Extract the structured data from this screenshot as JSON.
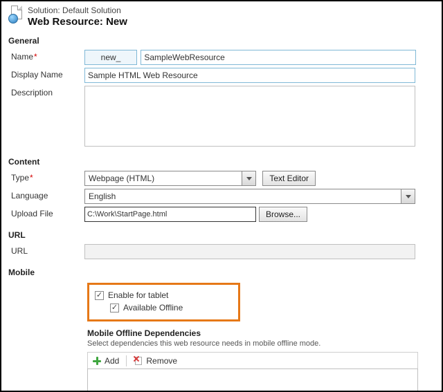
{
  "header": {
    "solution_label": "Solution:",
    "solution_name": "Default Solution",
    "title": "Web Resource: New"
  },
  "sections": {
    "general": "General",
    "content": "Content",
    "url": "URL",
    "mobile": "Mobile"
  },
  "labels": {
    "name": "Name",
    "display_name": "Display Name",
    "description": "Description",
    "type": "Type",
    "language": "Language",
    "upload_file": "Upload File",
    "url": "URL",
    "mobile_deps": "Mobile Offline Dependencies",
    "mobile_deps_desc": "Select dependencies this web resource needs in mobile offline mode."
  },
  "fields": {
    "name_prefix": "new_",
    "name_value": "SampleWebResource",
    "display_name_value": "Sample HTML Web Resource",
    "description_value": "",
    "type_selected": "Webpage (HTML)",
    "language_selected": "English",
    "upload_path": "C:\\Work\\StartPage.html",
    "url_value": ""
  },
  "buttons": {
    "text_editor": "Text Editor",
    "browse": "Browse...",
    "add": "Add",
    "remove": "Remove"
  },
  "mobile": {
    "enable_tablet": "Enable for tablet",
    "enable_tablet_checked": true,
    "available_offline": "Available Offline",
    "available_offline_checked": true
  }
}
